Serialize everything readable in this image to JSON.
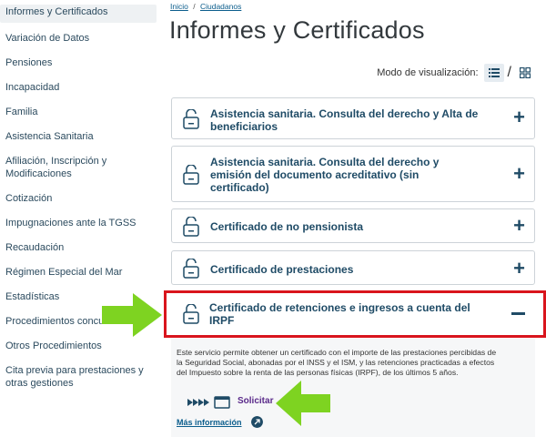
{
  "sidebar": {
    "items": [
      {
        "label": "Informes y Certificados"
      },
      {
        "label": "Variación de Datos"
      },
      {
        "label": "Pensiones"
      },
      {
        "label": "Incapacidad"
      },
      {
        "label": "Familia"
      },
      {
        "label": "Asistencia Sanitaria"
      },
      {
        "label": "Afiliación, Inscripción y"
      },
      {
        "label": "Modificaciones"
      },
      {
        "label": "Cotización"
      },
      {
        "label": "Impugnaciones ante la TGSS"
      },
      {
        "label": "Recaudación"
      },
      {
        "label": "Régimen Especial del Mar"
      },
      {
        "label": "Estadísticas"
      },
      {
        "label": "Procedimientos concur"
      },
      {
        "label": "Otros Procedimientos"
      },
      {
        "label": "Cita previa para prestaciones y"
      },
      {
        "label": "otras gestiones"
      }
    ]
  },
  "breadcrumb": {
    "home": "Inicio",
    "sep": "/",
    "section": "Ciudadanos"
  },
  "title": "Informes y Certificados",
  "view_mode_label": "Modo de visualización:",
  "view_sep": "/",
  "accordion": [
    {
      "line1": "Asistencia sanitaria. Consulta del derecho y Alta de",
      "line2": "beneficiarios",
      "line3": ""
    },
    {
      "line1": "Asistencia sanitaria. Consulta del derecho y",
      "line2": "emisión del documento acreditativo (sin",
      "line3": "certificado)"
    },
    {
      "line1": "Certificado de no pensionista",
      "line2": "",
      "line3": ""
    },
    {
      "line1": "Certificado de prestaciones",
      "line2": "",
      "line3": ""
    }
  ],
  "open_item": {
    "line1": "Certificado de retenciones e ingresos a cuenta del",
    "line2": "IRPF",
    "desc_line1": "Este servicio permite obtener un certificado con el importe de las prestaciones percibidas de",
    "desc_line2": "la Seguridad Social, abonadas por el INSS y el ISM, y las retenciones practicadas a efectos",
    "desc_line3": "del Impuesto sobre la renta de las personas físicas (IRPF), de los últimos 5 años.",
    "solicitar": "Solicitar",
    "mas_info": "Más información"
  },
  "colors": {
    "accent": "#1f4b66",
    "highlight": "#d9151d",
    "arrow": "#7ed321"
  }
}
